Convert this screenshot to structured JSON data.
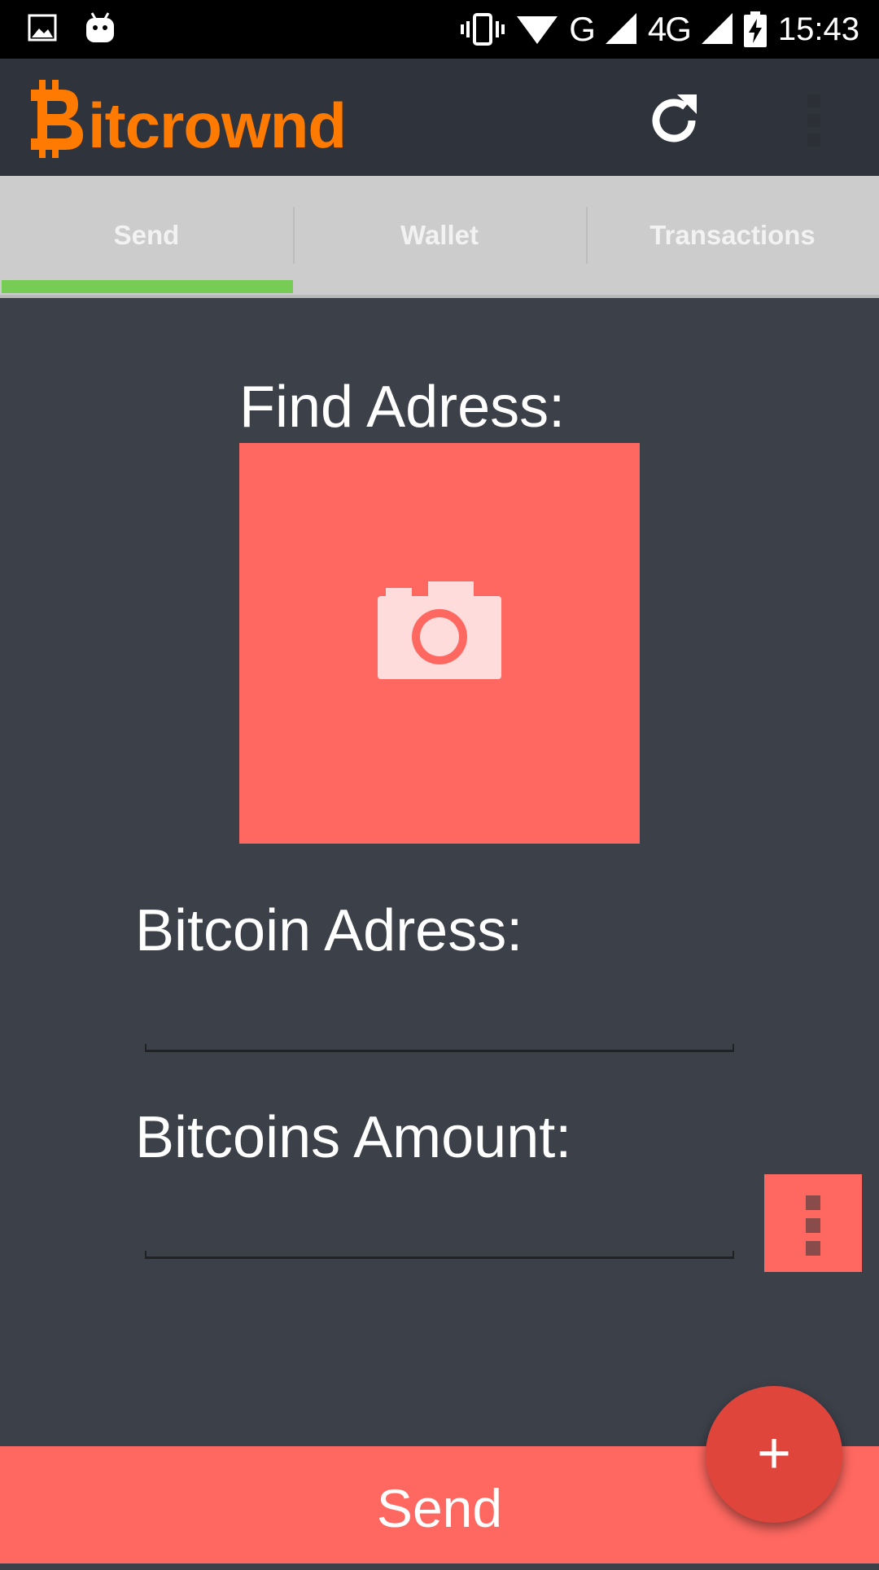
{
  "status_bar": {
    "network_g": "G",
    "network_4g": "4G",
    "time": "15:43"
  },
  "app": {
    "logo_text": "itcrownd",
    "logo_color": "#ff7a00",
    "refresh_icon": "refresh-icon",
    "overflow_icon": "more-vert-icon"
  },
  "tabs": [
    {
      "label": "Send",
      "selected": true
    },
    {
      "label": "Wallet",
      "selected": false
    },
    {
      "label": "Transactions",
      "selected": false
    }
  ],
  "send_form": {
    "find_address_label": "Find Adress:",
    "camera_icon": "camera-icon",
    "address_label": "Bitcoin Adress:",
    "address_value": "",
    "amount_label": "Bitcoins Amount:",
    "amount_value": "",
    "side_menu_icon": "more-vert-icon"
  },
  "footer": {
    "send_label": "Send",
    "fab_label": "+"
  },
  "colors": {
    "accent": "#ff6860",
    "tab_indicator": "#77cc55",
    "fab": "#e0453c",
    "background": "#3c4049"
  }
}
